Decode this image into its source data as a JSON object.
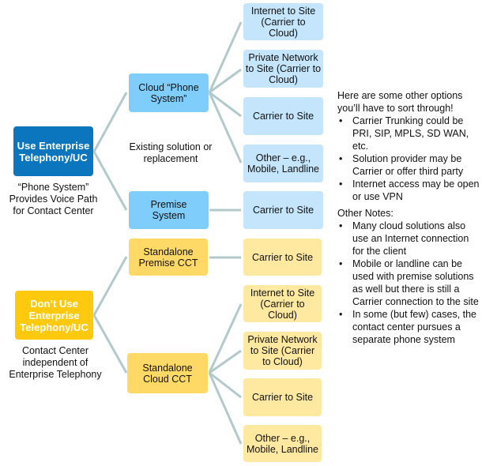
{
  "colors": {
    "blue_root": "#0b75bd",
    "blue_mid": "#7fcdfa",
    "blue_leaf": "#c4e5fb",
    "yellow_root": "#ffc90e",
    "yellow_mid": "#ffd966",
    "yellow_leaf": "#ffe9a0",
    "connector": "#b3c9cc"
  },
  "enterprise": {
    "root": "Use Enterprise Telephony/UC",
    "caption": "“Phone System” Provides Voice Path for Contact Center",
    "middle_label": "Existing solution or replacement",
    "cloud": "Cloud “Phone System”",
    "premise": "Premise System",
    "cloud_leaves": [
      "Internet to Site (Carrier to Cloud)",
      "Private Network to Site (Carrier to Cloud)",
      "Carrier to Site",
      "Other – e.g., Mobile, Landline"
    ],
    "premise_leaf": "Carrier to Site"
  },
  "standalone": {
    "root": "Don’t Use Enterprise Telephony/UC",
    "caption": "Contact Center independent of Enterprise Telephony",
    "premise": "Standalone Premise CCT",
    "cloud": "Standalone Cloud CCT",
    "premise_leaf": "Carrier to Site",
    "cloud_leaves": [
      "Internet to Site (Carrier to Cloud)",
      "Private Network to Site (Carrier to Cloud)",
      "Carrier to Site",
      "Other – e.g., Mobile, Landline"
    ]
  },
  "notes": {
    "intro": "Here are some other options you’ll have to sort through!",
    "options": [
      "Carrier Trunking could be PRI, SIP, MPLS, SD WAN, etc.",
      "Solution provider may be Carrier or offer third party",
      "Internet access may be open or use VPN"
    ],
    "other_heading": "Other Notes:",
    "other": [
      "Many cloud solutions also use an Internet connection for the client",
      "Mobile or landline can be used with premise solutions as well but there is still a Carrier connection to the site",
      "In some (but few) cases, the contact center pursues a separate phone system"
    ]
  }
}
